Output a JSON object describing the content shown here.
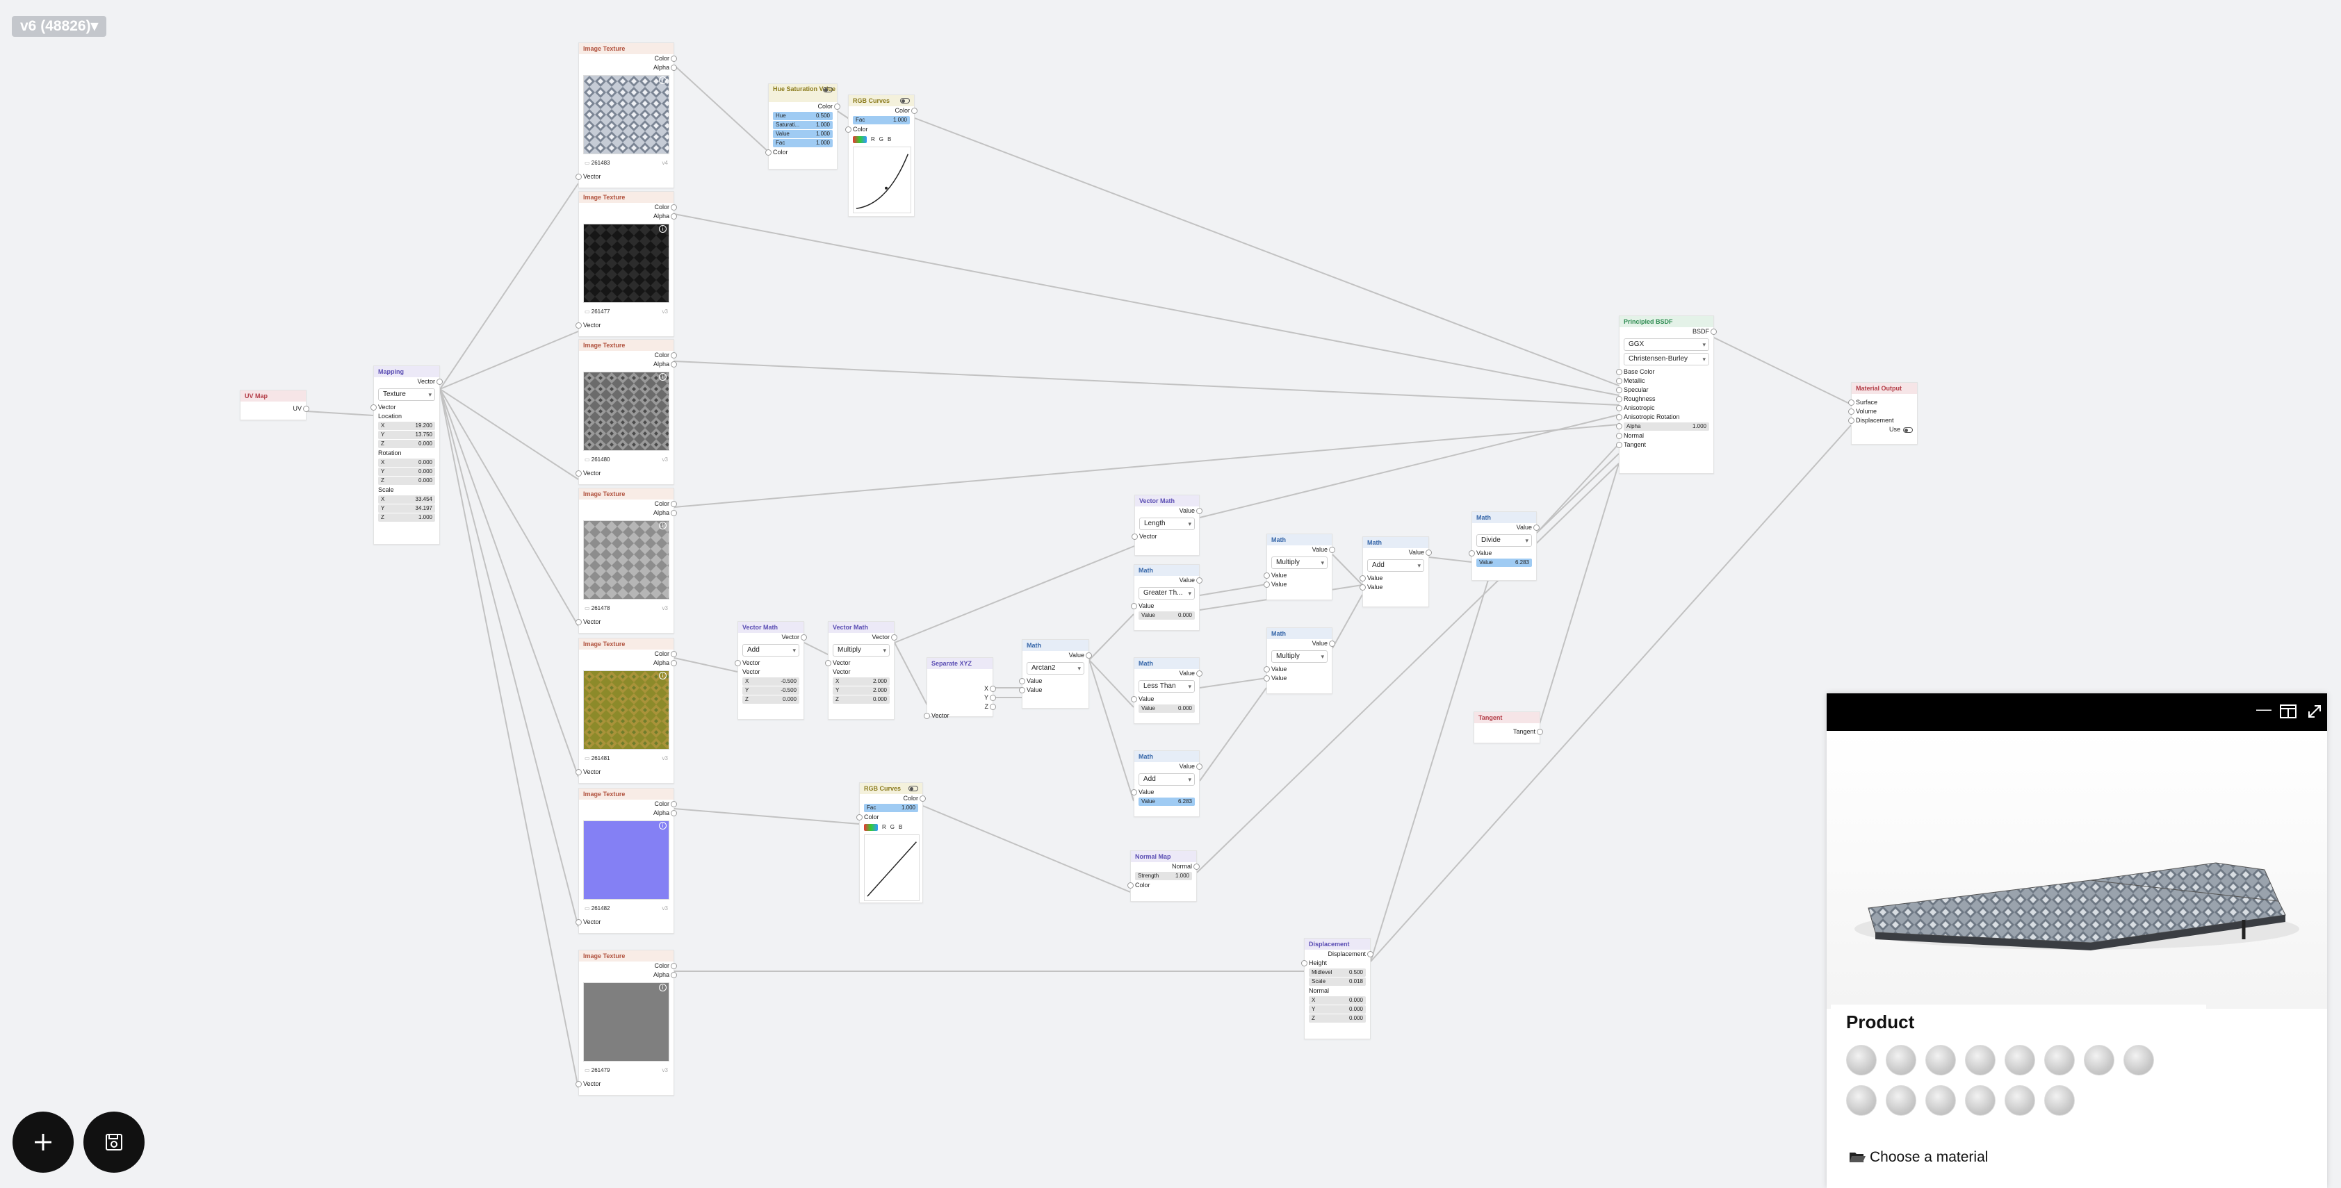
{
  "version_badge": "v6 (48826)▾",
  "nodes": {
    "uvmap": {
      "title": "UV Map",
      "out": "UV"
    },
    "mapping": {
      "title": "Mapping",
      "out": "Vector",
      "type": "Texture",
      "in_vector": "Vector",
      "location_label": "Location",
      "location": [
        "19.200",
        "13.750",
        "0.000"
      ],
      "rotation_label": "Rotation",
      "rotation": [
        "0.000",
        "0.000",
        "0.000"
      ],
      "scale_label": "Scale",
      "scale": [
        "33.454",
        "34.197",
        "1.000"
      ],
      "axes": [
        "X",
        "Y",
        "Z"
      ]
    },
    "textures": [
      {
        "title": "Image Texture",
        "color": "Color",
        "alpha": "Alpha",
        "id": "261483",
        "version": "v4",
        "vector": "Vector"
      },
      {
        "title": "Image Texture",
        "color": "Color",
        "alpha": "Alpha",
        "id": "261477",
        "version": "v3",
        "vector": "Vector"
      },
      {
        "title": "Image Texture",
        "color": "Color",
        "alpha": "Alpha",
        "id": "261480",
        "version": "v3",
        "vector": "Vector"
      },
      {
        "title": "Image Texture",
        "color": "Color",
        "alpha": "Alpha",
        "id": "261478",
        "version": "v3",
        "vector": "Vector"
      },
      {
        "title": "Image Texture",
        "color": "Color",
        "alpha": "Alpha",
        "id": "261481",
        "version": "v3",
        "vector": "Vector"
      },
      {
        "title": "Image Texture",
        "color": "Color",
        "alpha": "Alpha",
        "id": "261482",
        "version": "v3",
        "vector": "Vector"
      },
      {
        "title": "Image Texture",
        "color": "Color",
        "alpha": "Alpha",
        "id": "261479",
        "version": "v3",
        "vector": "Vector"
      }
    ],
    "hsv": {
      "title": "Hue Saturation Value",
      "out": "Color",
      "hue_l": "Hue",
      "hue": "0.500",
      "sat_l": "Saturati...",
      "sat": "1.000",
      "val_l": "Value",
      "val": "1.000",
      "fac_l": "Fac",
      "fac": "1.000",
      "in_color": "Color"
    },
    "curves1": {
      "title": "RGB Curves",
      "out": "Color",
      "fac_l": "Fac",
      "fac": "1.000",
      "in_color": "Color",
      "r": "R",
      "g": "G",
      "b": "B"
    },
    "curves2": {
      "title": "RGB Curves",
      "out": "Color",
      "fac_l": "Fac",
      "fac": "1.000",
      "in_color": "Color",
      "r": "R",
      "g": "G",
      "b": "B"
    },
    "vmath_add": {
      "title": "Vector Math",
      "out": "Vector",
      "op": "Add",
      "in1": "Vector",
      "in2": "Vector",
      "vals": [
        "-0.500",
        "-0.500",
        "0.000"
      ]
    },
    "vmath_mul": {
      "title": "Vector Math",
      "out": "Vector",
      "op": "Multiply",
      "in1": "Vector",
      "in2": "Vector",
      "vals": [
        "2.000",
        "2.000",
        "0.000"
      ]
    },
    "sepxyz": {
      "title": "Separate XYZ",
      "x": "X",
      "y": "Y",
      "z": "Z",
      "in": "Vector"
    },
    "atan": {
      "title": "Math",
      "out": "Value",
      "op": "Arctan2",
      "in1": "Value",
      "in2": "Value"
    },
    "vmath_len": {
      "title": "Vector Math",
      "out": "Value",
      "op": "Length",
      "in": "Vector"
    },
    "gt": {
      "title": "Math",
      "out": "Value",
      "op": "Greater Th...",
      "in1": "Value",
      "in2_l": "Value",
      "in2": "0.000"
    },
    "lt": {
      "title": "Math",
      "out": "Value",
      "op": "Less Than",
      "in1": "Value",
      "in2_l": "Value",
      "in2": "0.000"
    },
    "addpi": {
      "title": "Math",
      "out": "Value",
      "op": "Add",
      "in1": "Value",
      "in2_l": "Value",
      "in2": "6.283"
    },
    "mul1": {
      "title": "Math",
      "out": "Value",
      "op": "Multiply",
      "in1": "Value",
      "in2": "Value"
    },
    "mul2": {
      "title": "Math",
      "out": "Value",
      "op": "Multiply",
      "in1": "Value",
      "in2": "Value"
    },
    "add2": {
      "title": "Math",
      "out": "Value",
      "op": "Add",
      "in1": "Value",
      "in2": "Value"
    },
    "div": {
      "title": "Math",
      "out": "Value",
      "op": "Divide",
      "in1": "Value",
      "in2_l": "Value",
      "in2": "6.283"
    },
    "normalmap": {
      "title": "Normal Map",
      "out": "Normal",
      "str_l": "Strength",
      "str": "1.000",
      "in_color": "Color"
    },
    "disp": {
      "title": "Displacement",
      "out": "Displacement",
      "height": "Height",
      "mid_l": "Midlevel",
      "mid": "0.500",
      "scale_l": "Scale",
      "scale": "0.018",
      "normal": "Normal",
      "vec": [
        "0.000",
        "0.000",
        "0.000"
      ]
    },
    "tangent": {
      "title": "Tangent",
      "out": "Tangent"
    },
    "bsdf": {
      "title": "Principled BSDF",
      "out": "BSDF",
      "dist": "GGX",
      "sss": "Christensen-Burley",
      "inputs": [
        "Base Color",
        "Metallic",
        "Specular",
        "Roughness",
        "Anisotropic",
        "Anisotropic Rotation"
      ],
      "alpha_l": "Alpha",
      "alpha": "1.000",
      "normal": "Normal",
      "tangent": "Tangent"
    },
    "output": {
      "title": "Material Output",
      "surface": "Surface",
      "volume": "Volume",
      "disp": "Displacement",
      "use": "Use"
    }
  },
  "panel": {
    "product_title": "Product",
    "choose_material": "Choose a material",
    "thumbnail_count": 14
  },
  "icons": {
    "add": "plus-icon",
    "save": "save-icon",
    "minimize": "minimize-icon",
    "layout": "split-view-icon",
    "expand": "expand-icon",
    "folder": "folder-open-icon"
  }
}
